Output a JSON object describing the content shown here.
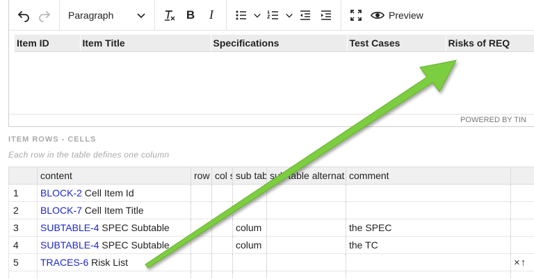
{
  "toolbar": {
    "paragraph_label": "Paragraph",
    "preview_label": "Preview",
    "icons": [
      "undo-icon",
      "redo-icon",
      "chevron-down-icon",
      "clear-format-icon",
      "bold-icon",
      "italic-icon",
      "bullet-list-icon",
      "numbered-list-icon",
      "outdent-icon",
      "indent-icon",
      "fullscreen-icon",
      "eye-icon"
    ],
    "bold_glyph": "B",
    "italic_glyph": "I"
  },
  "editor": {
    "table_headers": [
      "Item ID",
      "Item Title",
      "Specifications",
      "Test Cases",
      "Risks of REQ"
    ],
    "powered_by": "POWERED BY TIN"
  },
  "section": {
    "title": "ITEM ROWS - CELLS",
    "subtitle": "Each row in the table defines one column"
  },
  "grid": {
    "headers": [
      "",
      "content",
      "row",
      "col s",
      "sub tab",
      "sub table alternat",
      "comment",
      ""
    ],
    "rows": [
      {
        "num": "1",
        "ref": "BLOCK-2",
        "text": " Cell Item Id",
        "sub_tab": "",
        "comment": ""
      },
      {
        "num": "2",
        "ref": "BLOCK-7",
        "text": " Cell Item Title",
        "sub_tab": "",
        "comment": ""
      },
      {
        "num": "3",
        "ref": "SUBTABLE-4",
        "text": " SPEC Subtable",
        "sub_tab": "colum",
        "comment": "the SPEC"
      },
      {
        "num": "4",
        "ref": "SUBTABLE-4",
        "text": " SPEC Subtable",
        "sub_tab": "colum",
        "comment": "the TC"
      },
      {
        "num": "5",
        "ref": "TRACES-6",
        "text": " Risk List",
        "sub_tab": "",
        "comment": ""
      }
    ],
    "row_actions": "×↑"
  },
  "colors": {
    "link": "#1d27c9",
    "arrow": "#7dcd3f",
    "muted": "#a9a9a9"
  }
}
